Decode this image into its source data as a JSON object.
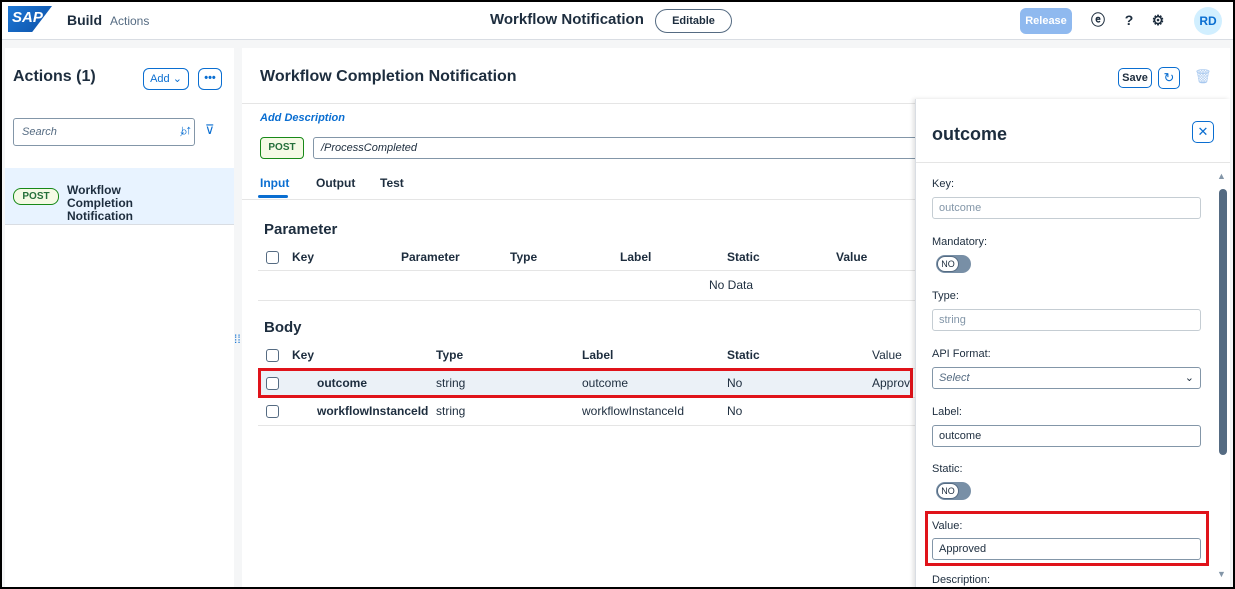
{
  "shell": {
    "logo": "SAP",
    "brand": "Build",
    "brand_sub": "Actions",
    "title": "Workflow Notification",
    "status_pill": "Editable",
    "release": "Release",
    "avatar": "RD",
    "icons": [
      "notification-icon",
      "help-icon",
      "settings-icon"
    ]
  },
  "left": {
    "title": "Actions (1)",
    "add_label": "Add",
    "more_label": "•••",
    "search_placeholder": "Search",
    "items": [
      {
        "method": "POST",
        "label": "Workflow Completion Notification"
      }
    ]
  },
  "main": {
    "title": "Workflow Completion Notification",
    "save": "Save",
    "add_description": "Add Description",
    "method": "POST",
    "endpoint": "/ProcessCompleted",
    "tabs": [
      "Input",
      "Output",
      "Test"
    ],
    "parameter": {
      "title": "Parameter",
      "columns": [
        "Key",
        "Parameter",
        "Type",
        "Label",
        "Static",
        "Value"
      ],
      "empty": "No Data"
    },
    "body": {
      "title": "Body",
      "columns": [
        "Key",
        "Type",
        "Label",
        "Static",
        "Value"
      ],
      "rows": [
        {
          "key": "outcome",
          "type": "string",
          "label": "outcome",
          "static": "No",
          "value": "Approved"
        },
        {
          "key": "workflowInstanceId",
          "type": "string",
          "label": "workflowInstanceId",
          "static": "No",
          "value": ""
        }
      ]
    }
  },
  "detail": {
    "title": "outcome",
    "key_label": "Key:",
    "key_value": "outcome",
    "mandatory_label": "Mandatory:",
    "mandatory_toggle": "NO",
    "type_label": "Type:",
    "type_value": "string",
    "api_format_label": "API Format:",
    "api_format_value": "Select",
    "label_label": "Label:",
    "label_value": "outcome",
    "static_label": "Static:",
    "static_toggle": "NO",
    "value_label": "Value:",
    "value_value": "Approved",
    "description_label": "Description:"
  },
  "colors": {
    "accent": "#0a6ed1",
    "highlight": "#e0131a",
    "post": "#188918"
  }
}
